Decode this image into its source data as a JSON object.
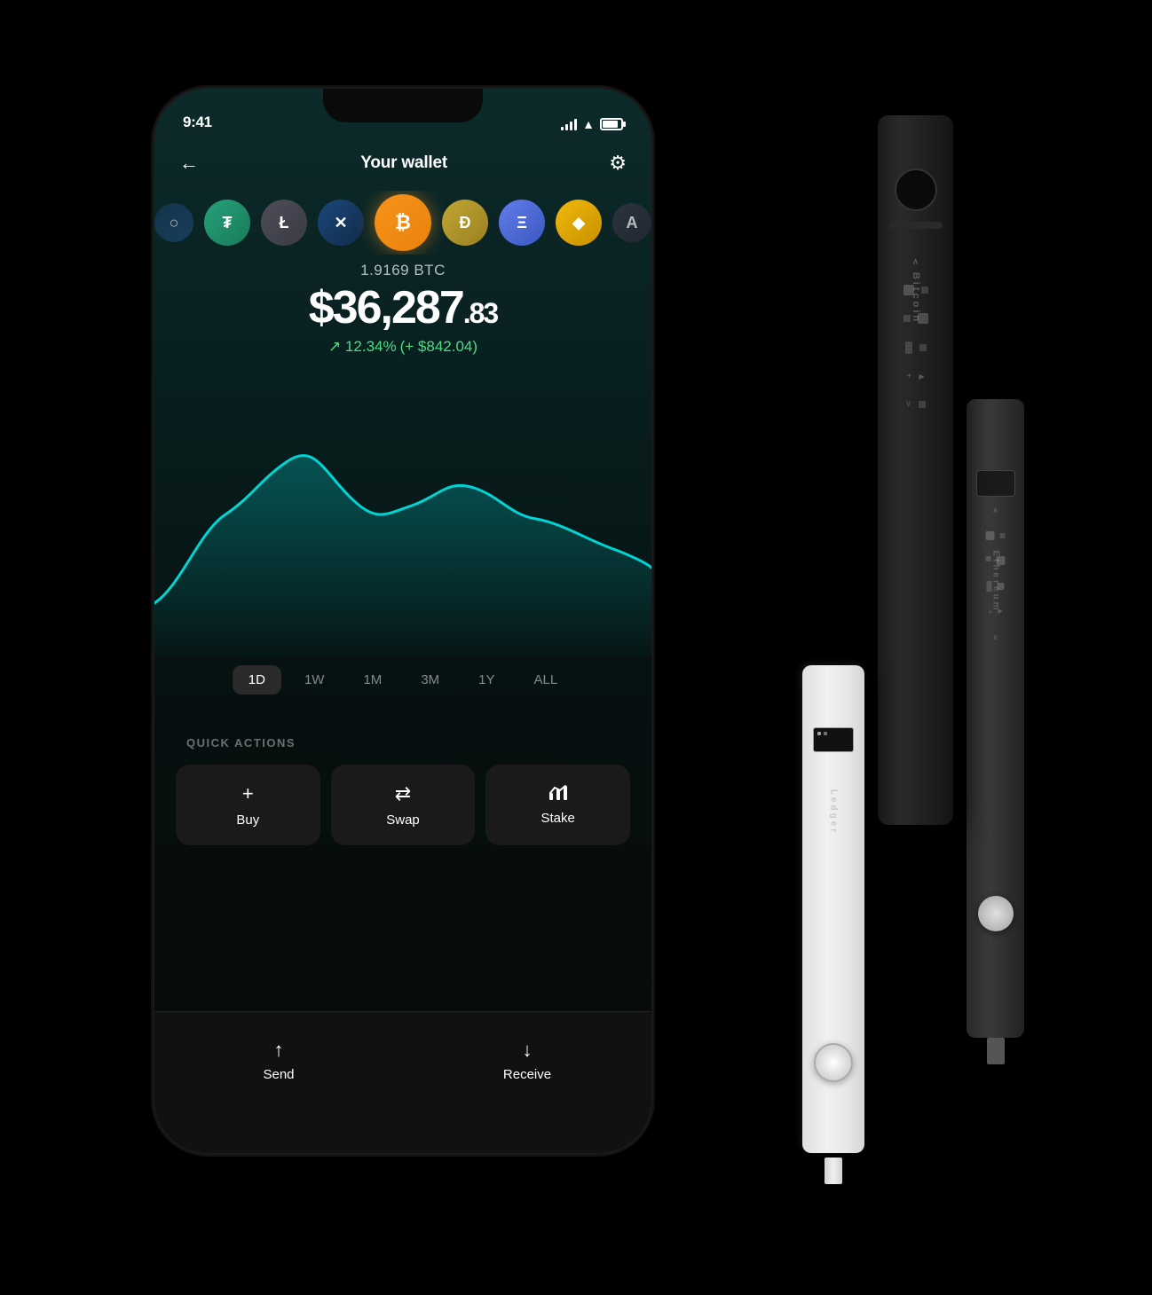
{
  "status_bar": {
    "time": "9:41",
    "signal": "signal-icon",
    "wifi": "wifi-icon",
    "battery": "battery-icon"
  },
  "header": {
    "back_label": "←",
    "title": "Your wallet",
    "settings_label": "⚙"
  },
  "coins": [
    {
      "id": "usdt",
      "symbol": "₮",
      "color": "#26a17b",
      "bg": "#1a3a2a"
    },
    {
      "id": "ltc",
      "symbol": "Ł",
      "color": "#bfbbbb",
      "bg": "#2a2a35"
    },
    {
      "id": "xrp",
      "symbol": "✕",
      "color": "#346aa9",
      "bg": "#1a2a3a"
    },
    {
      "id": "btc",
      "symbol": "₿",
      "color": "#fff",
      "bg": "#f7931a",
      "active": true
    },
    {
      "id": "doge",
      "symbol": "Ð",
      "color": "#fff",
      "bg": "#c2a633"
    },
    {
      "id": "eth",
      "symbol": "Ξ",
      "color": "#fff",
      "bg": "#627eea"
    },
    {
      "id": "bnb",
      "symbol": "◆",
      "color": "#fff",
      "bg": "#f3ba2f"
    }
  ],
  "balance": {
    "crypto_amount": "1.9169 BTC",
    "usd_main": "$36,287",
    "usd_cents": ".83",
    "change_percent": "↗ 12.34%",
    "change_usd": "(+ $842.04)",
    "change_color": "#4ade80"
  },
  "chart": {
    "label": "price chart"
  },
  "time_periods": [
    {
      "label": "1D",
      "active": true
    },
    {
      "label": "1W",
      "active": false
    },
    {
      "label": "1M",
      "active": false
    },
    {
      "label": "3M",
      "active": false
    },
    {
      "label": "1Y",
      "active": false
    },
    {
      "label": "ALL",
      "active": false
    }
  ],
  "quick_actions": {
    "label": "QUICK ACTIONS",
    "buttons": [
      {
        "id": "buy",
        "icon": "+",
        "label": "Buy"
      },
      {
        "id": "swap",
        "icon": "⇄",
        "label": "Swap"
      },
      {
        "id": "stake",
        "icon": "↑↑",
        "label": "Stake"
      }
    ]
  },
  "bottom_actions": [
    {
      "id": "send",
      "icon": "↑",
      "label": "Send"
    },
    {
      "id": "receive",
      "icon": "↓",
      "label": "Receive"
    }
  ],
  "ledger_devices": {
    "nano_x": {
      "label": "Ledger Nano X",
      "text": "Bitcoin"
    },
    "nano_s_black": {
      "label": "Ledger Nano S",
      "text": "Ethereum"
    },
    "nano_s_white": {
      "label": "Ledger Nano S Plus",
      "text": "Ledger"
    }
  }
}
